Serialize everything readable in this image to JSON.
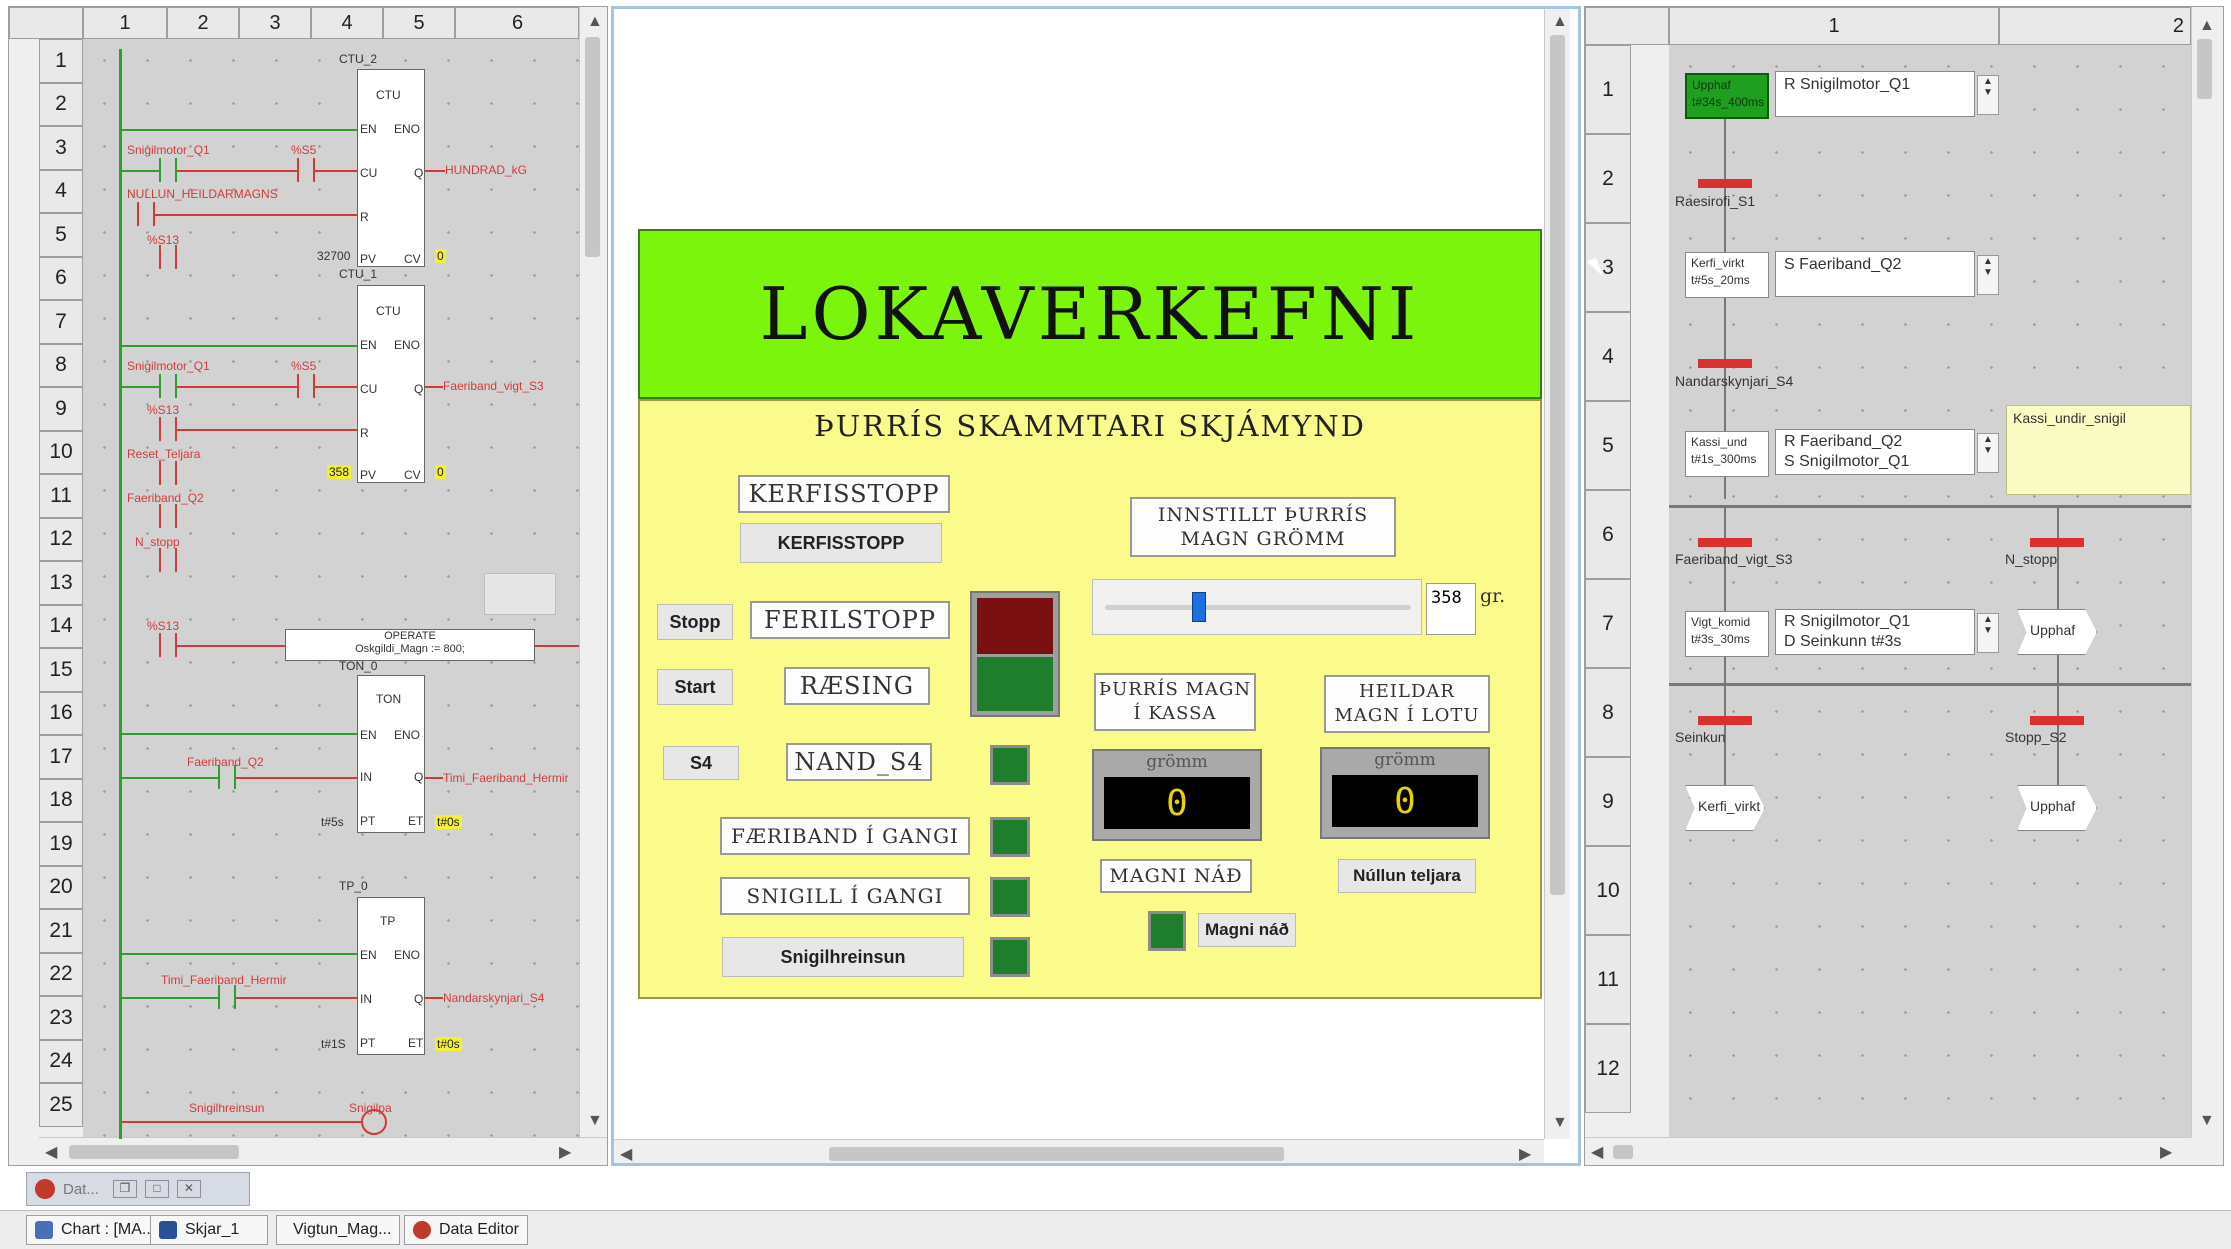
{
  "ladder": {
    "col_headers": [
      "1",
      "2",
      "3",
      "4",
      "5",
      "6"
    ],
    "row_numbers": [
      "1",
      "2",
      "3",
      "4",
      "5",
      "6",
      "7",
      "8",
      "9",
      "10",
      "11",
      "12",
      "13",
      "14",
      "15",
      "16",
      "17",
      "18",
      "19",
      "20",
      "21",
      "22",
      "23",
      "24",
      "25"
    ],
    "blocks": {
      "ctu2_name": "CTU_2",
      "ctu1_name": "CTU_1",
      "ton_name": "TON_0",
      "tp_name": "TP_0",
      "ctu_type": "CTU",
      "ton_type": "TON",
      "tp_type": "TP",
      "en": "EN",
      "eno": "ENO",
      "cu": "CU",
      "r": "R",
      "pv": "PV",
      "q": "Q",
      "cv": "CV",
      "in": "IN",
      "pt": "PT",
      "et": "ET"
    },
    "labels": {
      "snigilmotor1": "Snigilmotor_Q1",
      "s5a": "%S5",
      "hundrad": "HUNDRAD_kG",
      "nullun": "NULLUN_HEILDARMAGNS",
      "s13a": "%S13",
      "pv1": "32700",
      "cv1": "0",
      "snigilmotor2": "Snigilmotor_Q1",
      "s5b": "%S5",
      "faeriband_vigt": "Faeriband_vigt_S3",
      "s13b": "%S13",
      "reset": "Reset_Teljara",
      "faeriband_q2": "Faeriband_Q2",
      "n_stopp": "N_stopp",
      "pv2": "358",
      "cv2": "0",
      "s13c": "%S13",
      "operate_title": "OPERATE",
      "operate_expr": "Oskgildi_Magn := 800;",
      "faeriband_q2b": "Faeriband_Q2",
      "timi_hermir": "Timi_Faeriband_Hermir",
      "t5s": "t#5s",
      "et1": "t#0s",
      "timi_hermir2": "Timi_Faeriband_Hermir",
      "nandar": "Nandarskynjari_S4",
      "t1s": "t#1S",
      "et2": "t#0s",
      "snigilhreinsun": "Snigilhreinsun",
      "snigilpa": "Snigilpa"
    }
  },
  "hmi": {
    "title": "LOKAVERKEFNI",
    "subtitle": "ÞURRÍS SKAMMTARI SKJÁMYND",
    "kerfisstopp_box": "KERFISSTOPP",
    "kerfisstopp_btn": "KERFISSTOPP",
    "stopp_btn": "Stopp",
    "ferilstopp": "FERILSTOPP",
    "start_btn": "Start",
    "raesing": "RÆSING",
    "s4_btn": "S4",
    "nand_s4": "NAND_S4",
    "faeriband_gangi": "FÆRIBAND Í GANGI",
    "snigill_gangi": "SNIGILL Í GANGI",
    "snigilhreinsun_btn": "Snigilhreinsun",
    "innstillt_l1": "INNSTILLT ÞURRÍS",
    "innstillt_l2": "MAGN GRÖMM",
    "slider_value": "358",
    "slider_unit": "gr.",
    "slider_fraction": 0.3,
    "thurris_l1": "ÞURRÍS MAGN",
    "thurris_l2": "Í KASSA",
    "heildar_l1": "HEILDAR",
    "heildar_l2": "MAGN Í LOTU",
    "gromm1": "grömm",
    "gromm2": "grömm",
    "display1": "0",
    "display2": "0",
    "magni_nad_box": "MAGNI NÁÐ",
    "magni_nad_btn": "Magni náð",
    "nullun_btn": "Núllun teljara"
  },
  "sfc": {
    "col_headers": [
      "1",
      "2"
    ],
    "row_numbers": [
      "1",
      "2",
      "3",
      "4",
      "5",
      "6",
      "7",
      "8",
      "9",
      "10",
      "11",
      "12"
    ],
    "step1_l1": "Upphaf",
    "step1_l2": "t#34s_400ms",
    "action1": "R Snigilmotor_Q1",
    "trans1": "Raesirofi_S1",
    "step2_l1": "Kerfi_virkt",
    "step2_l2": "t#5s_20ms",
    "action2": "S Faeriband_Q2",
    "trans2": "Nandarskynjari_S4",
    "step3_l1": "Kassi_und",
    "step3_l2": "t#1s_300ms",
    "action3_l1": "R Faeriband_Q2",
    "action3_l2": "S Snigilmotor_Q1",
    "comment": "Kassi_undir_snigil",
    "trans3a": "Faeriband_vigt_S3",
    "trans3b": "N_stopp",
    "step4_l1": "Vigt_komid",
    "step4_l2": "t#3s_30ms",
    "action4_l1": "R Snigilmotor_Q1",
    "action4_l2": "D Seinkunn t#3s",
    "jump_a": "Upphaf",
    "trans4a": "Seinkun",
    "trans4b": "Stopp_S2",
    "jump_b": "Kerfi_virkt",
    "jump_c": "Upphaf"
  },
  "taskbar": {
    "mini": "Dat...",
    "items": [
      "Chart : [MA...",
      "Skjar_1",
      "Vigtun_Mag...",
      "Data Editor"
    ]
  },
  "colors": {
    "grid_bg": "#d2d2d2",
    "title_green": "#7cf50c",
    "panel_yellow": "#fbfb8c",
    "led_green": "#1f7e2e",
    "led_red": "#7a1010",
    "wire_red": "#d23a3a",
    "wire_green": "#2e9e2e"
  }
}
